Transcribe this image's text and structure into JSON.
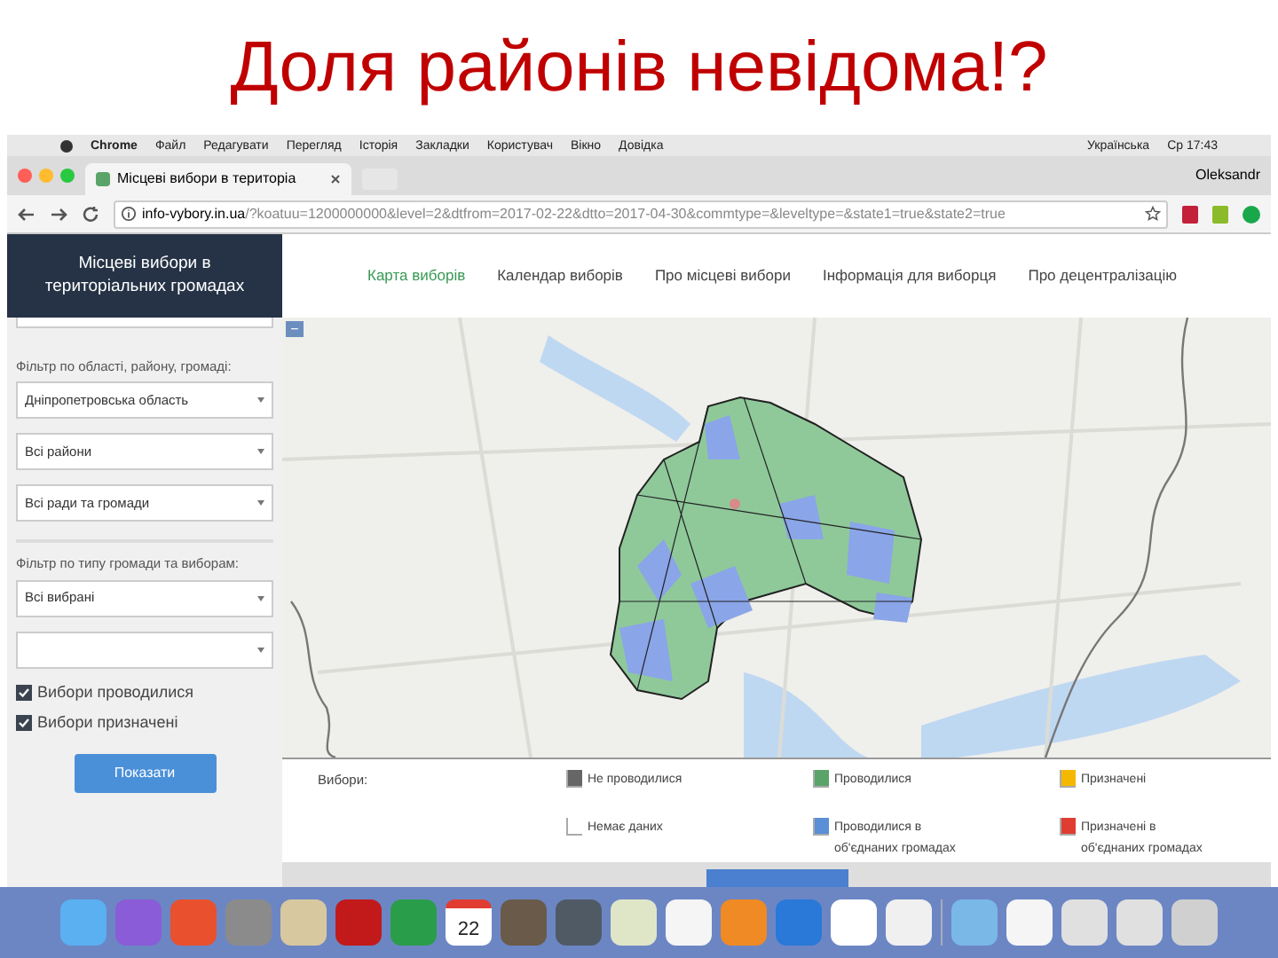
{
  "slide_title": "Доля районів невідома!?",
  "menu_bar": {
    "items": [
      "Chrome",
      "Файл",
      "Редагувати",
      "Перегляд",
      "Історія",
      "Закладки",
      "Користувач",
      "Вікно",
      "Довідка"
    ],
    "right": [
      "Українська",
      "Ср 17:43"
    ]
  },
  "browser": {
    "tab_title": "Місцеві вибори в територіа",
    "profile": "Oleksandr",
    "url_host": "info-vybory.in.ua",
    "url_rest": "/?koatuu=1200000000&level=2&dtfrom=2017-02-22&dtto=2017-04-30&commtype=&leveltype=&state1=true&state2=true"
  },
  "site_title": "Місцеві вибори в територіальних громадах",
  "nav": [
    {
      "label": "Карта виборів",
      "selected": true
    },
    {
      "label": "Календар виборів",
      "selected": false
    },
    {
      "label": "Про місцеві вибори",
      "selected": false
    },
    {
      "label": "Інформація для виборця",
      "selected": false
    },
    {
      "label": "Про децентралізацію",
      "selected": false
    }
  ],
  "sidebar": {
    "filter1_label": "Фільтр по області, району, громаді:",
    "selects1": [
      "Дніпропетровська область",
      "Всі райони",
      "Всі ради та громади"
    ],
    "filter2_label": "Фільтр по типу громади та виборам:",
    "selects2": [
      "Всі вибрані"
    ],
    "checkboxes": [
      {
        "label": "Вибори проводилися",
        "checked": true
      },
      {
        "label": "Вибори призначені",
        "checked": true
      }
    ],
    "button": "Показати"
  },
  "map": {
    "zoom_out": "−"
  },
  "legend": {
    "title": "Вибори:",
    "items": [
      {
        "label": "Не проводилися",
        "color": "#666666"
      },
      {
        "label": "Немає даних",
        "color": "#ffffff"
      },
      {
        "label": "Проводилися",
        "color": "#5aa469"
      },
      {
        "label": "Проводилися в об'єднаних громадах",
        "color": "#5b8fd6"
      },
      {
        "label": "Призначені",
        "color": "#f5b800"
      },
      {
        "label": "Призначені в об'єднаних громадах",
        "color": "#e03c31"
      }
    ]
  },
  "dock": {
    "calendar_day": "22"
  }
}
